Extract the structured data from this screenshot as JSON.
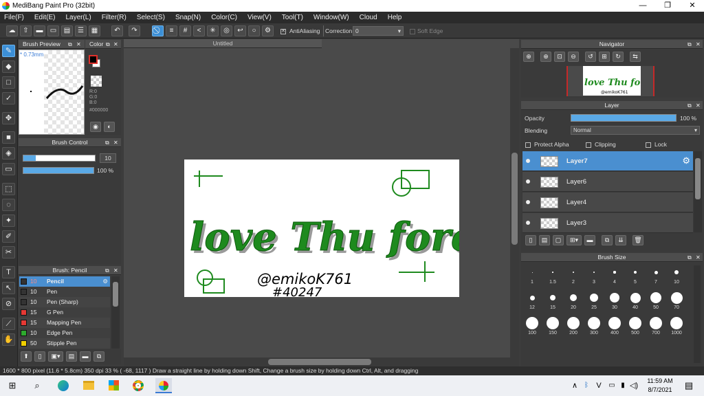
{
  "window": {
    "title": "MediBang Paint Pro (32bit)",
    "min": "—",
    "max": "❐",
    "close": "✕"
  },
  "menu": [
    "File(F)",
    "Edit(E)",
    "Layer(L)",
    "Filter(R)",
    "Select(S)",
    "Snap(N)",
    "Color(C)",
    "View(V)",
    "Tool(T)",
    "Window(W)",
    "Cloud",
    "Help"
  ],
  "toolbar": {
    "antialiasing_label": "AntiAliasing",
    "correction_label": "Correction",
    "correction_value": "0",
    "soft_edge_label": "Soft Edge"
  },
  "panels": {
    "brush_preview": {
      "title": "Brush Preview",
      "size_label": "* 0.73mm"
    },
    "color": {
      "title": "Color",
      "r": "R:0",
      "g": "G:0",
      "b": "B:0",
      "hex": "#000000"
    },
    "brush_control": {
      "title": "Brush Control",
      "size_value": "10",
      "opacity_value": "100 %",
      "opacity_level": 1.0
    },
    "brush_list": {
      "title": "Brush: Pencil",
      "items": [
        {
          "size": "10",
          "name": "Pencil",
          "color": "#333333",
          "selected": true
        },
        {
          "size": "10",
          "name": "Pen",
          "color": "#333333"
        },
        {
          "size": "10",
          "name": "Pen (Sharp)",
          "color": "#333333"
        },
        {
          "size": "15",
          "name": "G Pen",
          "color": "#e53935"
        },
        {
          "size": "15",
          "name": "Mapping Pen",
          "color": "#e53935"
        },
        {
          "size": "10",
          "name": "Edge Pen",
          "color": "#2eaa2e"
        },
        {
          "size": "50",
          "name": "Stipple Pen",
          "color": "#f0d000"
        }
      ]
    },
    "navigator": {
      "title": "Navigator"
    },
    "layer": {
      "title": "Layer",
      "opacity_label": "Opacity",
      "opacity_value": "100 %",
      "blending_label": "Blending",
      "blending_value": "Normal",
      "protect_alpha": "Protect Alpha",
      "clipping": "Clipping",
      "lock": "Lock",
      "layers": [
        "Layer7",
        "Layer6",
        "Layer4",
        "Layer3"
      ]
    },
    "brush_size": {
      "title": "Brush Size",
      "sizes": [
        "1",
        "1.5",
        "2",
        "3",
        "4",
        "5",
        "7",
        "10",
        "12",
        "15",
        "20",
        "25",
        "30",
        "40",
        "50",
        "70",
        "100",
        "150",
        "200",
        "300",
        "400",
        "500",
        "700",
        "1000"
      ]
    }
  },
  "canvas": {
    "tab_title": "Untitled",
    "script_text": "love Thu forever",
    "handle_line1": "@emikoK761",
    "handle_line2": "#40247",
    "ink_color": "#1e8a1e",
    "shadow_color": "#9a9a9a"
  },
  "status": {
    "text": "1600 * 800 pixel  (11.6 * 5.8cm)  350 dpi  33 %  ( -68, 1117 )  Draw a straight line by holding down Shift, Change a brush size by holding down Ctrl, Alt, and dragging"
  },
  "taskbar": {
    "time": "11:59 AM",
    "date": "8/7/2021"
  },
  "icons": [
    "windows-icon",
    "search-icon",
    "edge-icon",
    "explorer-icon",
    "store-icon",
    "chrome-icon",
    "medibang-icon",
    "chevron-up-icon",
    "bluetooth-icon",
    "vpn-icon",
    "network-icon",
    "volume-icon",
    "notification-icon"
  ]
}
